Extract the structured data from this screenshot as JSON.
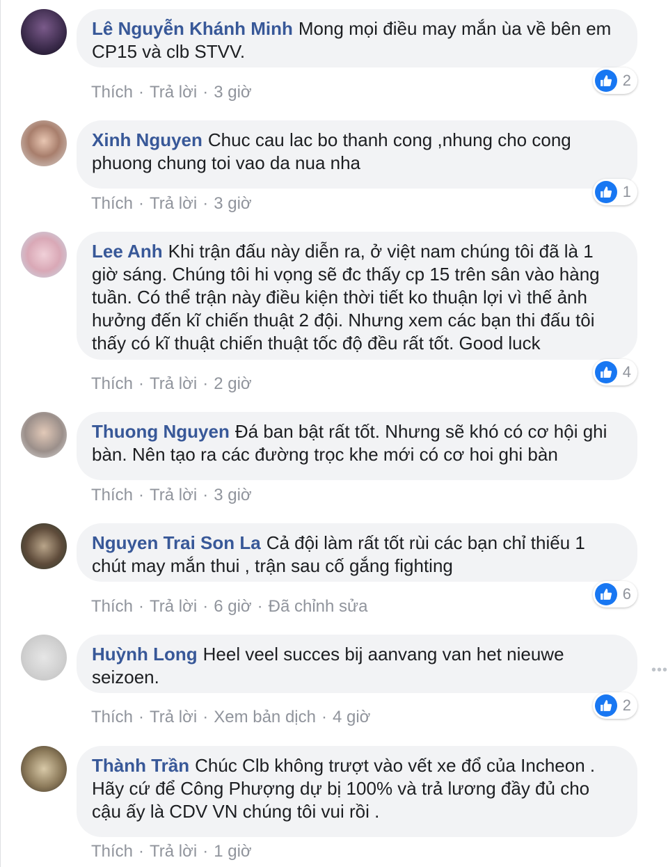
{
  "comments": [
    {
      "author": "Lê Nguyễn Khánh Minh",
      "text": "Mong mọi điều may mắn ùa về bên em CP15 và clb STVV.",
      "like": "Thích",
      "reply": "Trả lời",
      "time": "3 giờ",
      "reactions": "2"
    },
    {
      "author": "Xinh Nguyen",
      "text": "Chuc cau lac bo thanh cong ,nhung cho cong phuong chung toi vao da nua nha",
      "like": "Thích",
      "reply": "Trả lời",
      "time": "3 giờ",
      "reactions": "1"
    },
    {
      "author": "Lee Anh",
      "text": "Khi trận đấu này diễn ra, ở việt nam chúng tôi đã là 1 giờ sáng. Chúng tôi hi vọng sẽ đc thấy cp 15 trên sân vào hàng tuần. Có thể trận này điều kiện thời tiết ko thuận lợi vì thế ảnh hưởng đến kĩ chiến thuật 2 đội. Nhưng xem các bạn thi đấu tôi thấy có kĩ thuật chiến thuật tốc độ đều rất tốt. Good luck",
      "like": "Thích",
      "reply": "Trả lời",
      "time": "2 giờ",
      "reactions": "4"
    },
    {
      "author": "Thuong Nguyen",
      "text": "Đá ban bật rất tốt. Nhưng sẽ khó có cơ hội ghi bàn. Nên tạo ra các đường trọc khe mới có cơ hoi ghi bàn",
      "like": "Thích",
      "reply": "Trả lời",
      "time": "3 giờ"
    },
    {
      "author": "Nguyen Trai Son La",
      "text": "Cả đội làm rất tốt rùi các bạn chỉ thiếu 1 chút may mắn thui , trận sau cố gắng fighting",
      "like": "Thích",
      "reply": "Trả lời",
      "time": "6 giờ",
      "edited": "Đã chỉnh sửa",
      "reactions": "6"
    },
    {
      "author": "Huỳnh Long",
      "text": "Heel veel succes bij aanvang van het nieuwe seizoen.",
      "like": "Thích",
      "reply": "Trả lời",
      "translate": "Xem bản dịch",
      "time": "4 giờ",
      "reactions": "2"
    },
    {
      "author": "Thành Trần",
      "text": "Chúc Clb không trượt vào vết xe đổ của Incheon . Hãy cứ để Công Phượng dự bị 100% và trả lương đầy đủ cho cậu ấy là CDV VN chúng tôi vui rồi .",
      "like": "Thích",
      "reply": "Trả lời",
      "time": "1 giờ"
    }
  ],
  "colors": {
    "author": "#385898",
    "bubble": "#f2f3f5",
    "meta": "#90949c",
    "like": "#1877f2"
  },
  "icons": {
    "reaction": "like-thumb-icon",
    "more": "more-options-icon"
  }
}
